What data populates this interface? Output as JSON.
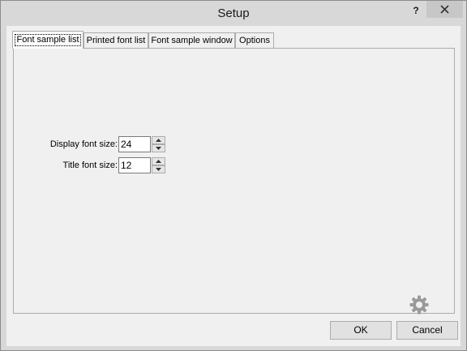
{
  "window": {
    "title": "Setup",
    "help_label": "?"
  },
  "tabs": [
    {
      "label": "Font sample list",
      "active": true
    },
    {
      "label": "Printed font list",
      "active": false
    },
    {
      "label": "Font sample window",
      "active": false
    },
    {
      "label": "Options",
      "active": false
    }
  ],
  "fields": {
    "display_font_size": {
      "label": "Display font size:",
      "value": "24"
    },
    "title_font_size": {
      "label": "Title font size:",
      "value": "12"
    }
  },
  "buttons": {
    "ok": "OK",
    "cancel": "Cancel"
  },
  "icons": {
    "close": "close-icon",
    "settings": "gear-icon",
    "spin_up": "chevron-up-icon",
    "spin_down": "chevron-down-icon"
  }
}
